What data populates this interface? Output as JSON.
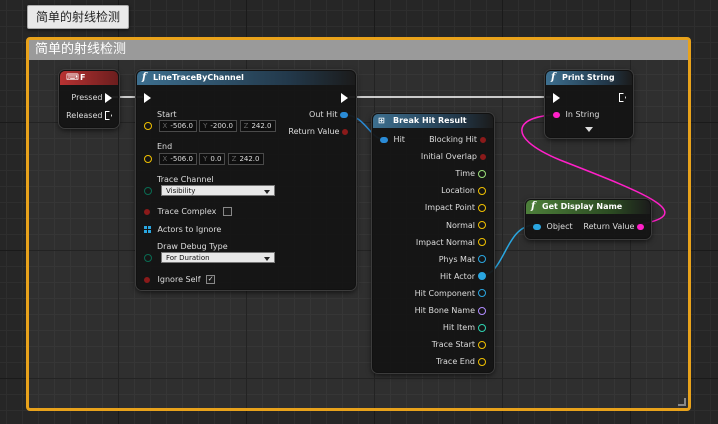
{
  "tooltip": "简单的射线检测",
  "comment": {
    "title": "简单的射线检测"
  },
  "colors": {
    "exec": "#ffffff",
    "struct": "#2a8bd6",
    "vector": "#f0c000",
    "bool": "#8b1a1a",
    "float": "#9be07a",
    "object": "#2aa6e0",
    "string": "#ff20c8",
    "name": "#b08cff",
    "enum": "#0a6b52",
    "comment_border": "#e8a21b"
  },
  "key_node": {
    "title": "F",
    "icon": "keyboard-icon",
    "pressed": "Pressed",
    "released": "Released"
  },
  "trace_node": {
    "title": "LineTraceByChannel",
    "start_label": "Start",
    "start": {
      "x": "-506.0",
      "y": "-200.0",
      "z": "242.0"
    },
    "end_label": "End",
    "end": {
      "x": "-506.0",
      "y": "0.0",
      "z": "242.0"
    },
    "trace_channel_label": "Trace Channel",
    "trace_channel_value": "Visibility",
    "trace_complex_label": "Trace Complex",
    "actors_to_ignore_label": "Actors to Ignore",
    "draw_debug_type_label": "Draw Debug Type",
    "draw_debug_type_value": "For Duration",
    "ignore_self_label": "Ignore Self",
    "out_hit_label": "Out Hit",
    "return_value_label": "Return Value",
    "axis": {
      "x": "X",
      "y": "Y",
      "z": "Z"
    }
  },
  "break_node": {
    "title": "Break Hit Result",
    "hit_label": "Hit",
    "outputs": [
      "Blocking Hit",
      "Initial Overlap",
      "Time",
      "Location",
      "Impact Point",
      "Normal",
      "Impact Normal",
      "Phys Mat",
      "Hit Actor",
      "Hit Component",
      "Hit Bone Name",
      "Hit Item",
      "Trace Start",
      "Trace End"
    ]
  },
  "print_node": {
    "title": "Print String",
    "in_string_label": "In String"
  },
  "display_name_node": {
    "title": "Get Display Name",
    "object_label": "Object",
    "return_value_label": "Return Value"
  }
}
